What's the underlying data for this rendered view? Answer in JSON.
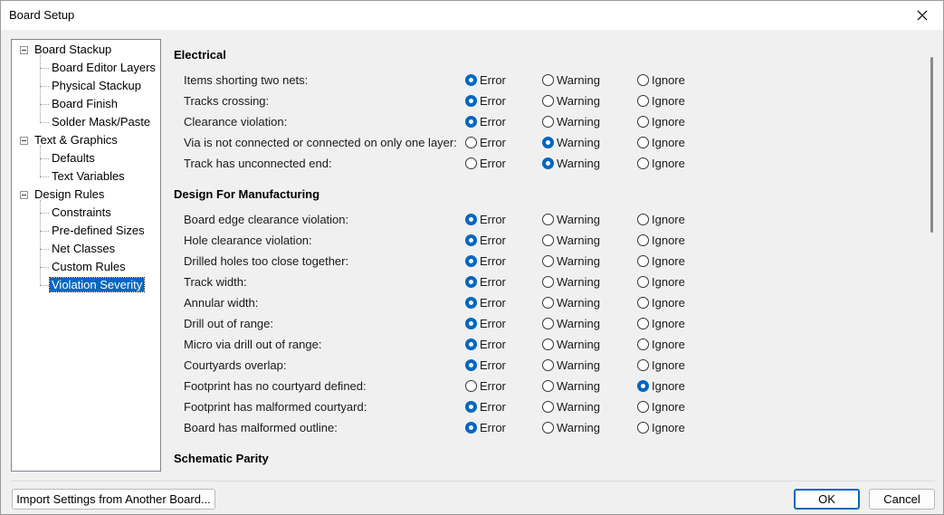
{
  "window": {
    "title": "Board Setup"
  },
  "tree": [
    {
      "label": "Board Stackup",
      "level": 0,
      "expander": true
    },
    {
      "label": "Board Editor Layers",
      "level": 1
    },
    {
      "label": "Physical Stackup",
      "level": 1
    },
    {
      "label": "Board Finish",
      "level": 1
    },
    {
      "label": "Solder Mask/Paste",
      "level": 1
    },
    {
      "label": "Text & Graphics",
      "level": 0,
      "expander": true
    },
    {
      "label": "Defaults",
      "level": 1
    },
    {
      "label": "Text Variables",
      "level": 1
    },
    {
      "label": "Design Rules",
      "level": 0,
      "expander": true
    },
    {
      "label": "Constraints",
      "level": 1
    },
    {
      "label": "Pre-defined Sizes",
      "level": 1
    },
    {
      "label": "Net Classes",
      "level": 1
    },
    {
      "label": "Custom Rules",
      "level": 1
    },
    {
      "label": "Violation Severity",
      "level": 1,
      "selected": true
    }
  ],
  "severity_labels": {
    "error": "Error",
    "warning": "Warning",
    "ignore": "Ignore"
  },
  "sections": [
    {
      "title": "Electrical",
      "rows": [
        {
          "label": "Items shorting two nets:",
          "value": "error"
        },
        {
          "label": "Tracks crossing:",
          "value": "error"
        },
        {
          "label": "Clearance violation:",
          "value": "error"
        },
        {
          "label": "Via is not connected or connected on only one layer:",
          "value": "warning"
        },
        {
          "label": "Track has unconnected end:",
          "value": "warning"
        }
      ]
    },
    {
      "title": "Design For Manufacturing",
      "rows": [
        {
          "label": "Board edge clearance violation:",
          "value": "error"
        },
        {
          "label": "Hole clearance violation:",
          "value": "error"
        },
        {
          "label": "Drilled holes too close together:",
          "value": "error"
        },
        {
          "label": "Track width:",
          "value": "error"
        },
        {
          "label": "Annular width:",
          "value": "error"
        },
        {
          "label": "Drill out of range:",
          "value": "error"
        },
        {
          "label": "Micro via drill out of range:",
          "value": "error"
        },
        {
          "label": "Courtyards overlap:",
          "value": "error"
        },
        {
          "label": "Footprint has no courtyard defined:",
          "value": "ignore"
        },
        {
          "label": "Footprint has malformed courtyard:",
          "value": "error"
        },
        {
          "label": "Board has malformed outline:",
          "value": "error"
        }
      ]
    },
    {
      "title": "Schematic Parity",
      "rows": []
    }
  ],
  "buttons": {
    "import": "Import Settings from Another Board...",
    "ok": "OK",
    "cancel": "Cancel"
  }
}
